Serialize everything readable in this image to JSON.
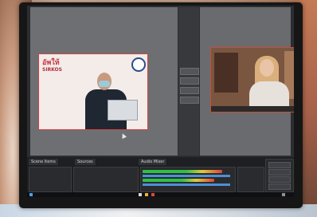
{
  "scene": {
    "description_tags": [
      "monitor-photo",
      "livestream-software"
    ]
  },
  "preview": {
    "banner_line_1": "อัพให้",
    "banner_line_2": "SIRKOS"
  },
  "dock": {
    "tabs": [
      "Scene Items",
      "Sources",
      "Audio Mixer"
    ]
  },
  "colors": {
    "monitor_bezel": "#161616",
    "screen_bg": "#2c2d30",
    "highlight_border": "#d04444",
    "meter_green": "#2fbf4a",
    "meter_yellow": "#e2c83a",
    "meter_red": "#d8453a"
  }
}
